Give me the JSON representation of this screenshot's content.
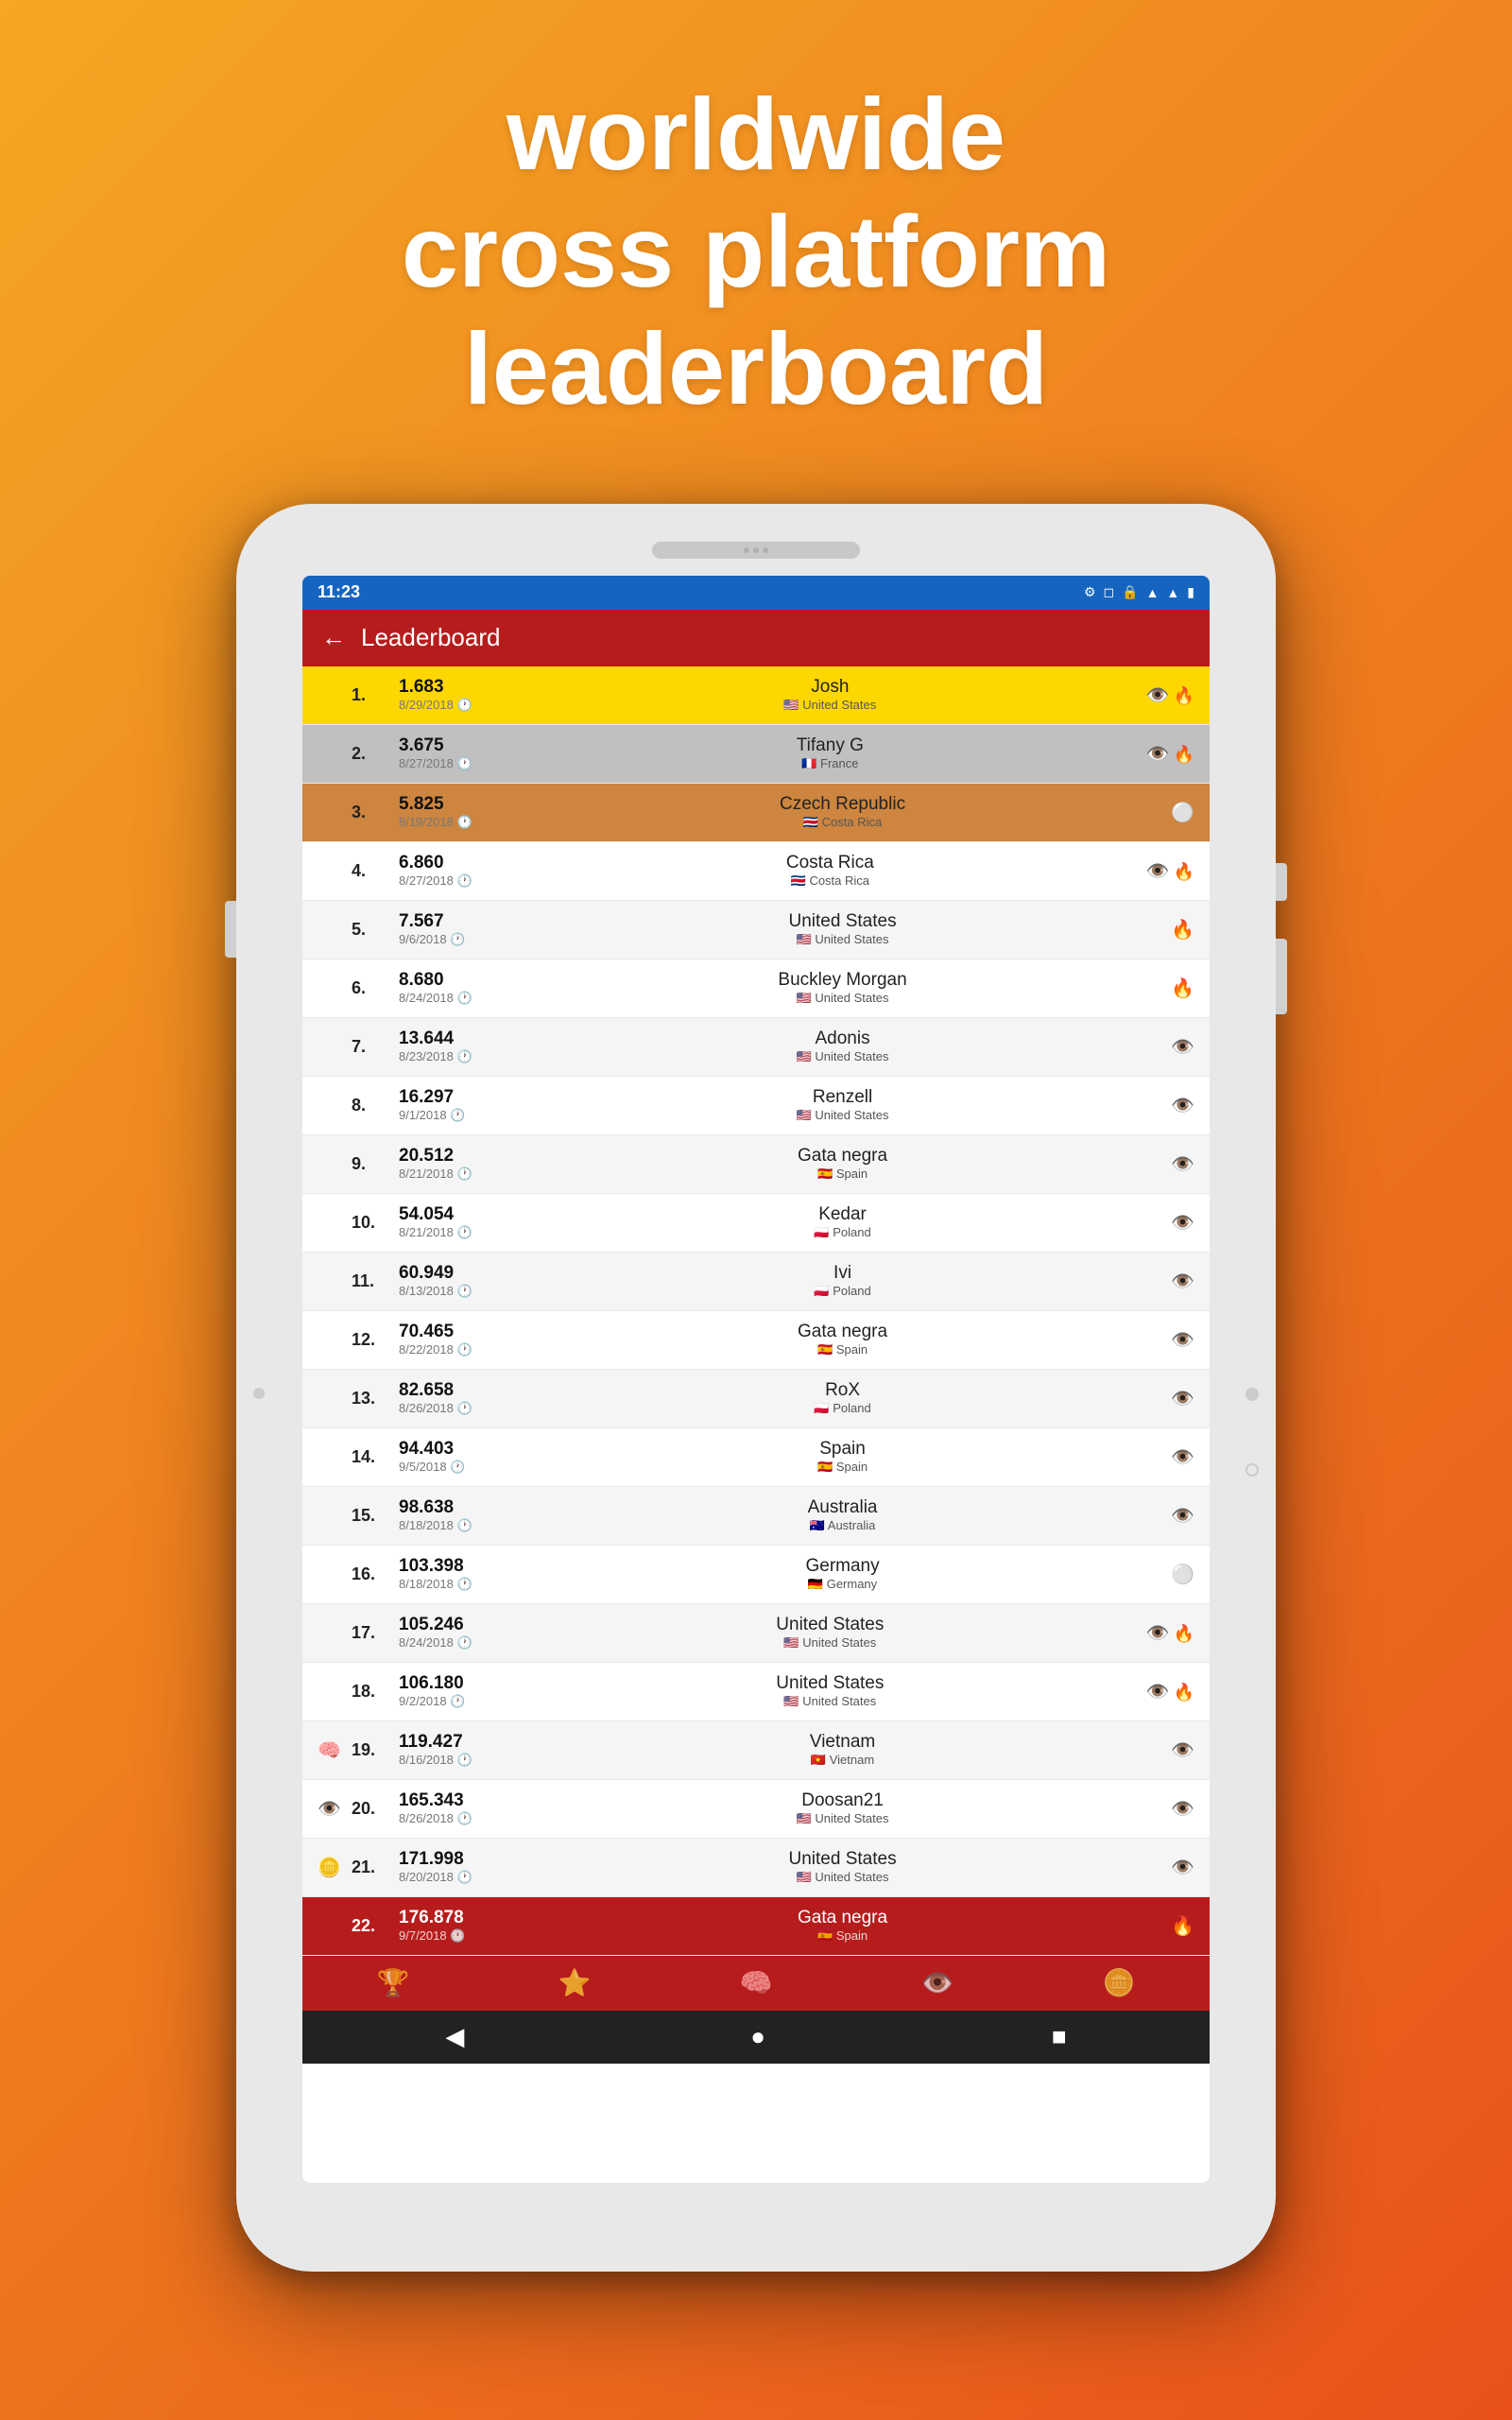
{
  "headline": {
    "line1": "worldwide",
    "line2": "cross platform",
    "line3": "leaderboard"
  },
  "status_bar": {
    "time": "11:23",
    "wifi": "▲",
    "battery": "■"
  },
  "app_bar": {
    "title": "Leaderboard",
    "back": "←"
  },
  "entries": [
    {
      "rank": "1.",
      "score": "1.683",
      "date": "8/29/2018",
      "name": "Josh",
      "country": "United States",
      "flag": "🇺🇸",
      "tier": "gold",
      "icon": "👁️",
      "extra_icon": "🔥"
    },
    {
      "rank": "2.",
      "score": "3.675",
      "date": "8/27/2018",
      "name": "Tifany G",
      "country": "France",
      "flag": "🇫🇷",
      "tier": "silver",
      "icon": "👁️",
      "extra_icon": "🔥"
    },
    {
      "rank": "3.",
      "score": "5.825",
      "date": "8/19/2018",
      "name": "Czech Republic",
      "country": "Costa Rica",
      "flag": "🇨🇷",
      "tier": "bronze",
      "icon": "⚪"
    },
    {
      "rank": "4.",
      "score": "6.860",
      "date": "8/27/2018",
      "name": "Costa Rica",
      "country": "Costa Rica",
      "flag": "🇨🇷",
      "tier": "white",
      "icon": "👁️",
      "extra_icon": "🔥"
    },
    {
      "rank": "5.",
      "score": "7.567",
      "date": "9/6/2018",
      "name": "United States",
      "country": "United States",
      "flag": "🇺🇸",
      "tier": "light",
      "icon": "🔥"
    },
    {
      "rank": "6.",
      "score": "8.680",
      "date": "8/24/2018",
      "name": "Buckley Morgan",
      "country": "United States",
      "flag": "🇺🇸",
      "tier": "white",
      "icon": "🔥"
    },
    {
      "rank": "7.",
      "score": "13.644",
      "date": "8/23/2018",
      "name": "Adonis",
      "country": "United States",
      "flag": "🇺🇸",
      "tier": "light",
      "icon": "👁️"
    },
    {
      "rank": "8.",
      "score": "16.297",
      "date": "9/1/2018",
      "name": "Renzell",
      "country": "United States",
      "flag": "🇺🇸",
      "tier": "white",
      "icon": "👁️"
    },
    {
      "rank": "9.",
      "score": "20.512",
      "date": "8/21/2018",
      "name": "Gata negra",
      "country": "Spain",
      "flag": "🇪🇸",
      "tier": "light",
      "icon": "👁️"
    },
    {
      "rank": "10.",
      "score": "54.054",
      "date": "8/21/2018",
      "name": "Kedar",
      "country": "Poland",
      "flag": "🇵🇱",
      "tier": "white",
      "icon": "👁️"
    },
    {
      "rank": "11.",
      "score": "60.949",
      "date": "8/13/2018",
      "name": "Ivi",
      "country": "Poland",
      "flag": "🇵🇱",
      "tier": "light",
      "icon": "👁️"
    },
    {
      "rank": "12.",
      "score": "70.465",
      "date": "8/22/2018",
      "name": "Gata negra",
      "country": "Spain",
      "flag": "🇪🇸",
      "tier": "white",
      "icon": "👁️"
    },
    {
      "rank": "13.",
      "score": "82.658",
      "date": "8/26/2018",
      "name": "RoX",
      "country": "Poland",
      "flag": "🇵🇱",
      "tier": "light",
      "icon": "👁️"
    },
    {
      "rank": "14.",
      "score": "94.403",
      "date": "9/5/2018",
      "name": "Spain",
      "country": "Spain",
      "flag": "🇪🇸",
      "tier": "white",
      "icon": "👁️"
    },
    {
      "rank": "15.",
      "score": "98.638",
      "date": "8/18/2018",
      "name": "Australia",
      "country": "Australia",
      "flag": "🇦🇺",
      "tier": "light",
      "icon": "👁️"
    },
    {
      "rank": "16.",
      "score": "103.398",
      "date": "8/18/2018",
      "name": "Germany",
      "country": "Germany",
      "flag": "🇩🇪",
      "tier": "white",
      "icon": "⚪"
    },
    {
      "rank": "17.",
      "score": "105.246",
      "date": "8/24/2018",
      "name": "United States",
      "country": "United States",
      "flag": "🇺🇸",
      "tier": "light",
      "icon": "👁️",
      "extra_icon": "🔥"
    },
    {
      "rank": "18.",
      "score": "106.180",
      "date": "9/2/2018",
      "name": "United States",
      "country": "United States",
      "flag": "🇺🇸",
      "tier": "white",
      "icon": "👁️",
      "extra_icon": "🔥"
    },
    {
      "rank": "19.",
      "score": "119.427",
      "date": "8/16/2018",
      "name": "Vietnam",
      "country": "Vietnam",
      "flag": "🇻🇳",
      "tier": "light",
      "icon": "👁️",
      "left_icons": [
        "🧠"
      ]
    },
    {
      "rank": "20.",
      "score": "165.343",
      "date": "8/26/2018",
      "name": "Doosan21",
      "country": "United States",
      "flag": "🇺🇸",
      "tier": "white",
      "icon": "👁️",
      "left_icons": [
        "👁️"
      ]
    },
    {
      "rank": "21.",
      "score": "171.998",
      "date": "8/20/2018",
      "name": "United States",
      "country": "United States",
      "flag": "🇺🇸",
      "tier": "light",
      "icon": "👁️",
      "left_icons": [
        "🪙"
      ]
    },
    {
      "rank": "22.",
      "score": "176.878",
      "date": "9/7/2018",
      "name": "Gata negra",
      "country": "Spain",
      "flag": "🇪🇸",
      "tier": "bottom-bar",
      "icon": "🔥"
    }
  ],
  "bottom_tabs": [
    "🏆",
    "🟨",
    "🧠",
    "👁️",
    "🪙"
  ],
  "nav_buttons": [
    "◀",
    "●",
    "■"
  ]
}
